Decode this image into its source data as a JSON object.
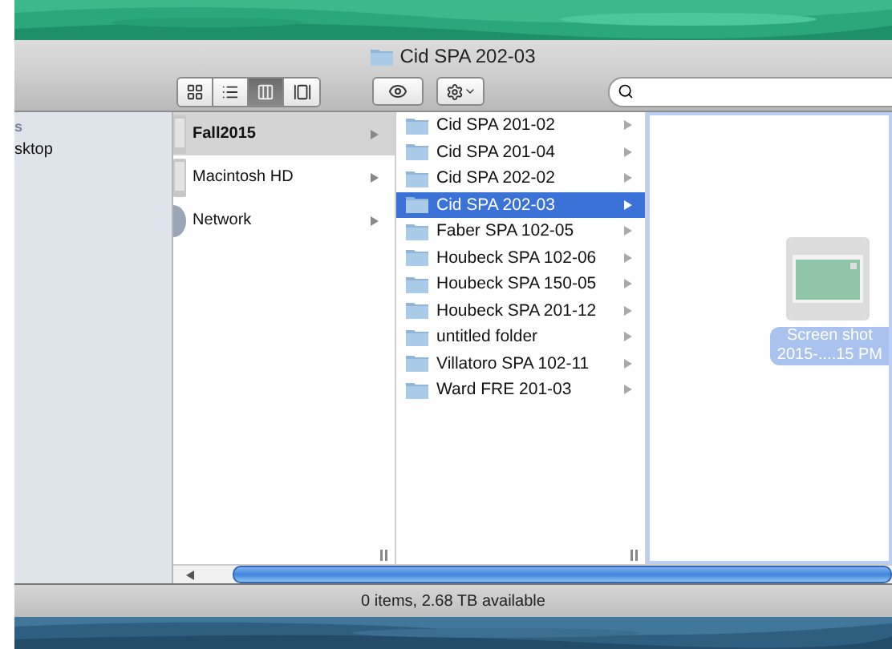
{
  "window": {
    "title": "Cid SPA 202-03"
  },
  "view_modes": [
    {
      "kind": "icons",
      "selected": false
    },
    {
      "kind": "list",
      "selected": false
    },
    {
      "kind": "columns",
      "selected": true
    },
    {
      "kind": "coverflow",
      "selected": false
    }
  ],
  "sidebar": {
    "heading": "s",
    "items": [
      "sktop"
    ]
  },
  "sources": [
    {
      "name": "Fall2015",
      "kind": "drive",
      "selected": true
    },
    {
      "name": "Macintosh HD",
      "kind": "drive",
      "selected": false
    },
    {
      "name": "Network",
      "kind": "network",
      "selected": false
    }
  ],
  "folders": [
    {
      "name": "Cid SPA 201-02",
      "selected": false
    },
    {
      "name": "Cid SPA 201-04",
      "selected": false
    },
    {
      "name": "Cid SPA 202-02",
      "selected": false
    },
    {
      "name": "Cid SPA 202-03",
      "selected": true
    },
    {
      "name": "Faber SPA 102-05",
      "selected": false
    },
    {
      "name": "Houbeck SPA 102-06",
      "selected": false
    },
    {
      "name": "Houbeck SPA 150-05",
      "selected": false
    },
    {
      "name": "Houbeck SPA 201-12",
      "selected": false
    },
    {
      "name": "untitled folder",
      "selected": false
    },
    {
      "name": "Villatoro SPA 102-11",
      "selected": false
    },
    {
      "name": "Ward FRE 201-03",
      "selected": false
    }
  ],
  "preview": {
    "file_name": [
      "Screen shot",
      "2015-....15 PM"
    ]
  },
  "status_bar": "0 items, 2.68 TB available"
}
